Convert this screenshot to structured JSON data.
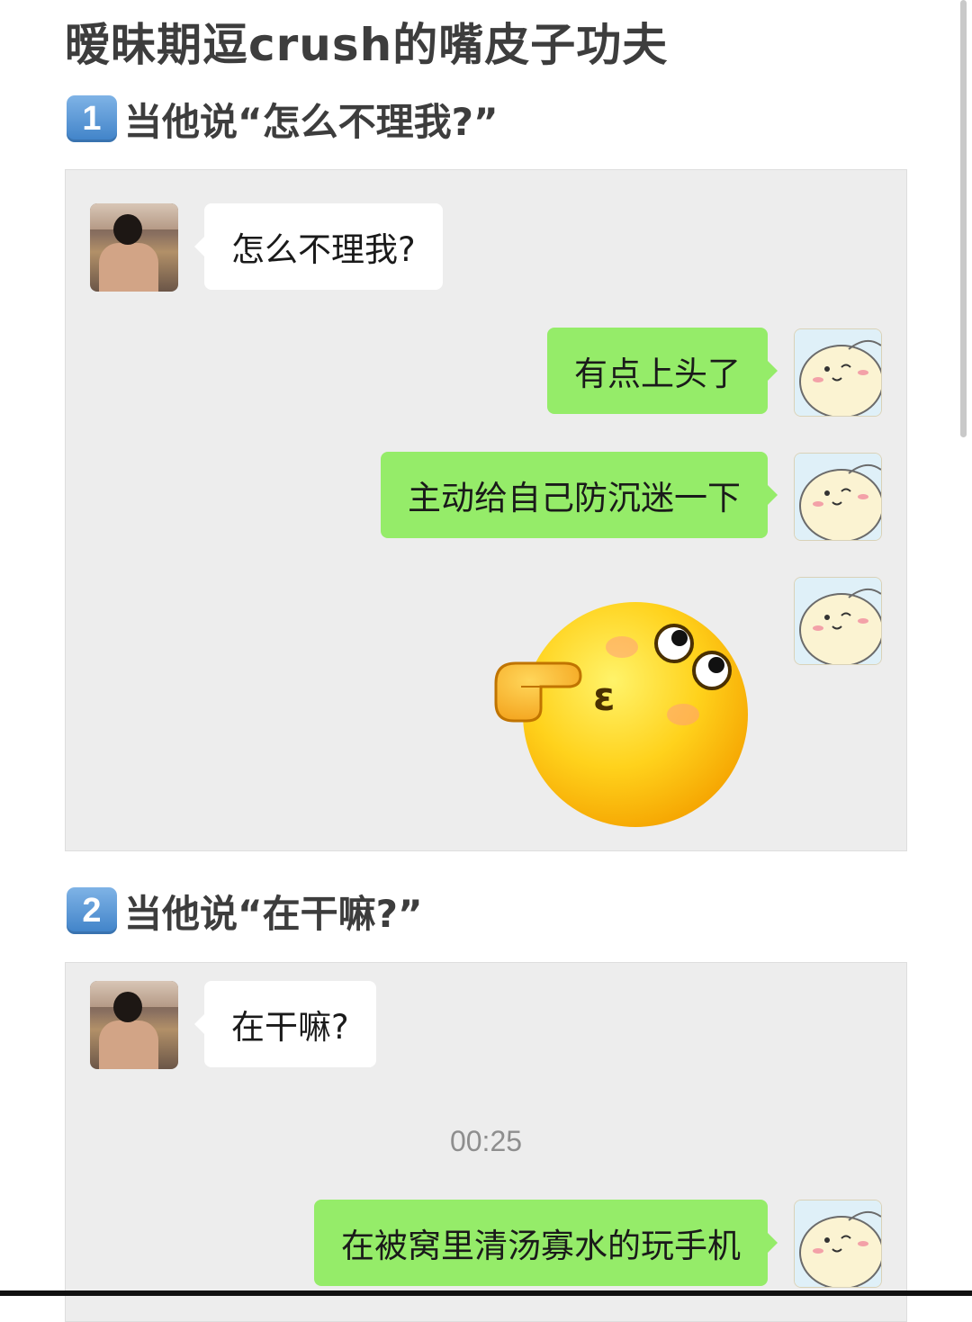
{
  "title": "暧昧期逗crush的嘴皮子功夫",
  "sections": [
    {
      "number": "1",
      "heading": "当他说“怎么不理我?”",
      "messages": [
        {
          "from": "him",
          "type": "text",
          "text": "怎么不理我?"
        },
        {
          "from": "me",
          "type": "text",
          "text": "有点上头了"
        },
        {
          "from": "me",
          "type": "text",
          "text": "主动给自己防沉迷一下"
        },
        {
          "from": "me",
          "type": "sticker",
          "sticker": "pointing-thinking-emoji"
        }
      ]
    },
    {
      "number": "2",
      "heading": "当他说“在干嘛?”",
      "messages": [
        {
          "from": "him",
          "type": "text",
          "text": "在干嘛?"
        },
        {
          "type": "timestamp",
          "text": "00:25"
        },
        {
          "from": "me",
          "type": "text",
          "text": "在被窝里清汤寡水的玩手机"
        }
      ]
    }
  ],
  "colors": {
    "panel_bg": "#ededed",
    "incoming_bubble": "#ffffff",
    "outgoing_bubble": "#95ec69",
    "badge": "#4f8fd0"
  }
}
